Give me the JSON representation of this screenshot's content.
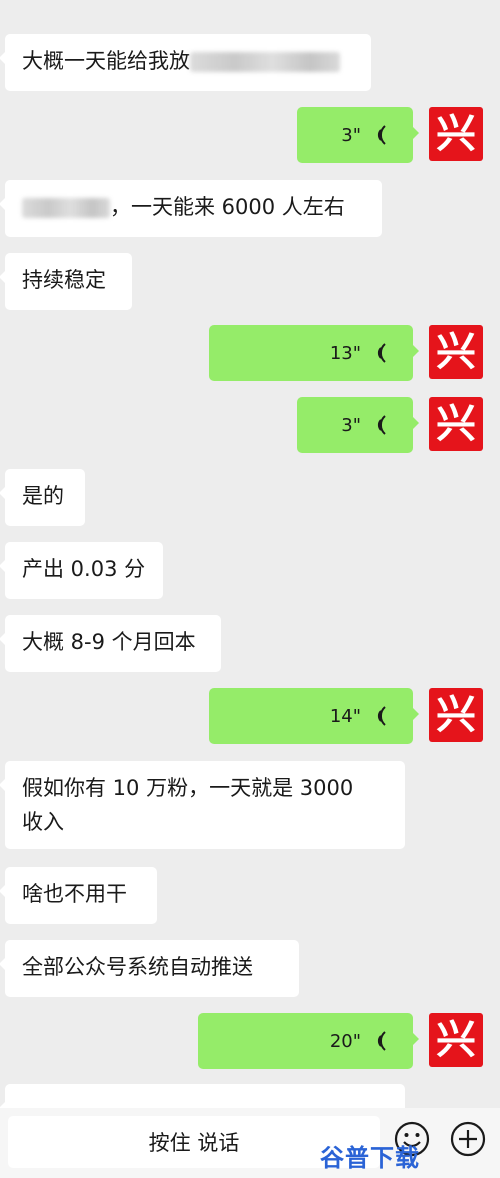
{
  "chat": {
    "messages": [
      {
        "type": "text",
        "side": "left",
        "text": "大概一天能给我放"
      },
      {
        "type": "voice",
        "side": "right",
        "duration": "3\""
      },
      {
        "type": "text",
        "side": "left",
        "text": "，一天能来 6000 人左右"
      },
      {
        "type": "text",
        "side": "left",
        "text": "持续稳定"
      },
      {
        "type": "voice",
        "side": "right",
        "duration": "13\""
      },
      {
        "type": "voice",
        "side": "right",
        "duration": "3\""
      },
      {
        "type": "text",
        "side": "left",
        "text": "是的"
      },
      {
        "type": "text",
        "side": "left",
        "text": "产出 0.03 分"
      },
      {
        "type": "text",
        "side": "left",
        "text": "大概 8-9 个月回本"
      },
      {
        "type": "voice",
        "side": "right",
        "duration": "14\""
      },
      {
        "type": "text",
        "side": "left",
        "text_line1": "假如你有 10 万粉，一天就是 3000",
        "text_line2": "收入"
      },
      {
        "type": "text",
        "side": "left",
        "text": "啥也不用干"
      },
      {
        "type": "text",
        "side": "left",
        "text": "全部公众号系统自动推送"
      },
      {
        "type": "voice",
        "side": "right",
        "duration": "20\""
      }
    ],
    "avatar_char": "兴"
  },
  "input_bar": {
    "hold_to_talk": "按住 说话",
    "emoji_icon": "emoji-icon",
    "plus_icon": "plus-icon"
  },
  "watermark": {
    "text": "谷普下载"
  },
  "colors": {
    "background": "#ededed",
    "bubble_left": "#ffffff",
    "bubble_right": "#95ec69",
    "avatar": "#e5141b",
    "watermark": "#2a63d6"
  }
}
